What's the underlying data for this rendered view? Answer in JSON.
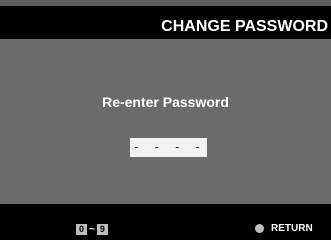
{
  "header": {
    "title": "CHANGE PASSWORD"
  },
  "dialog": {
    "prompt": "Re-enter Password",
    "password_mask": "- - - -"
  },
  "footer": {
    "key_start": "0",
    "key_separator": "~",
    "key_end": "9",
    "return_label": "RETURN",
    "return_icon": "circle-button-icon"
  }
}
